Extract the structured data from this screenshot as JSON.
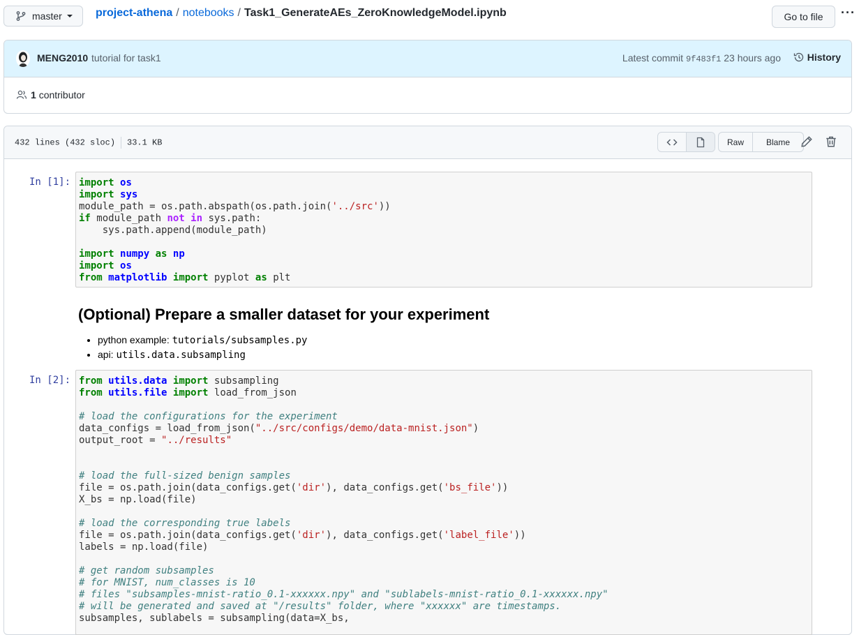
{
  "header": {
    "branch": "master",
    "repo": "project-athena",
    "folder": "notebooks",
    "file": "Task1_GenerateAEs_ZeroKnowledgeModel.ipynb",
    "goto_label": "Go to file",
    "more_label": "···"
  },
  "commit": {
    "author": "MENG2010",
    "message": "tutorial for task1",
    "latest_label": "Latest commit",
    "sha": "9f483f1",
    "time": "23 hours ago",
    "history_label": "History",
    "contributor_count": "1",
    "contributor_label": "contributor"
  },
  "file_info": {
    "lines": "432 lines (432 sloc)",
    "size": "33.1 KB",
    "raw_label": "Raw",
    "blame_label": "Blame"
  },
  "notebook": {
    "cell1_prompt": "In [1]:",
    "cell2_prompt": "In [2]:",
    "heading": "(Optional) Prepare a smaller dataset for your experiment",
    "bullets": [
      {
        "label": "python example:",
        "code": "tutorials/subsamples.py"
      },
      {
        "label": "api:",
        "code": "utils.data.subsampling"
      }
    ]
  },
  "colors": {
    "link": "#0969da",
    "commit_bg": "#ddf4ff",
    "prompt": "#303f9f",
    "keyword": "#008000",
    "string": "#ba2121",
    "comment": "#408080"
  }
}
